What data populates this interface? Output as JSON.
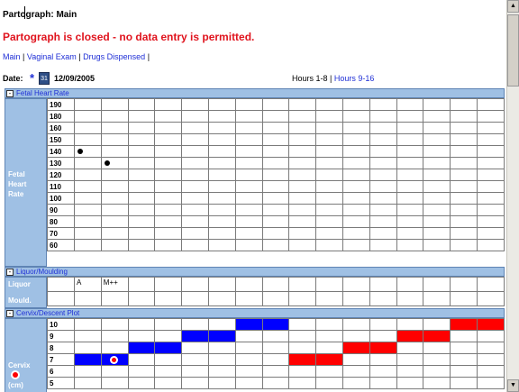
{
  "header": {
    "title": "Partograph: Main",
    "closed_message": "Partograph is closed - no data entry is permitted."
  },
  "nav": {
    "items": [
      "Main",
      "Vaginal Exam",
      "Drugs Dispensed"
    ],
    "separator": "|"
  },
  "date": {
    "label": "Date:",
    "required_marker": "*",
    "value": "12/09/2005",
    "calendar_icon_text": "31"
  },
  "hours": {
    "current": "Hours 1-8",
    "link": "Hours 9-16",
    "separator": "|"
  },
  "sections": {
    "fetal_heart_rate": {
      "title": "Fetal Heart Rate",
      "side_label": "Fetal\nHeart\nRate",
      "rows": [
        "190",
        "180",
        "160",
        "150",
        "140",
        "130",
        "120",
        "110",
        "100",
        "90",
        "80",
        "70",
        "60"
      ],
      "points": [
        {
          "col": 1,
          "value": "140"
        },
        {
          "col": 2,
          "value": "130"
        }
      ]
    },
    "liquor_moulding": {
      "title": "Liquor/Moulding",
      "liquor_label": "Liquor",
      "moulding_label": "Mould.",
      "liquor_values": [
        "A",
        "M++"
      ]
    },
    "cervix_descent": {
      "title": "Cervix/Descent Plot",
      "side_label": "Cervix",
      "unit_label": "(cm)",
      "rows": [
        "10",
        "9",
        "8",
        "7",
        "6",
        "5"
      ]
    }
  },
  "colors": {
    "header_bar": "#9fc0e4",
    "link": "#1f2fd6",
    "alert": "#e0141e",
    "alert_line": "#0000ff",
    "action_line": "#ff0000"
  },
  "toggle_symbol": "-"
}
